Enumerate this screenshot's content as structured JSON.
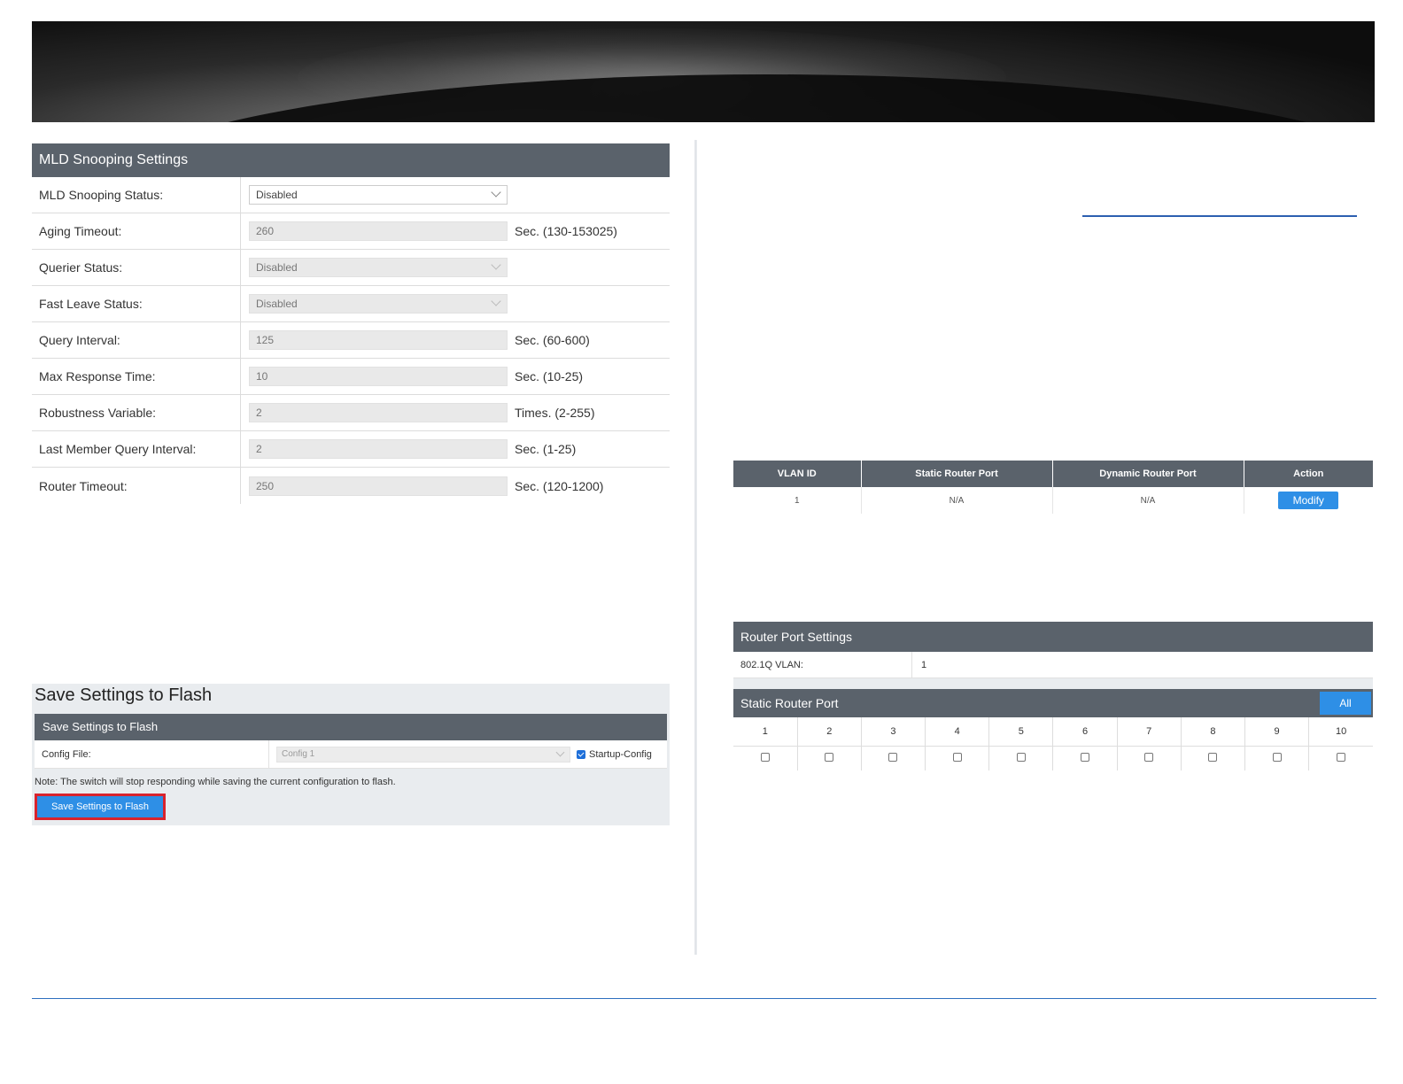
{
  "mld": {
    "title": "MLD Snooping Settings",
    "rows": [
      {
        "label": "MLD Snooping Status:",
        "value": "Disabled",
        "unit": ""
      },
      {
        "label": "Aging Timeout:",
        "value": "260",
        "unit": "Sec. (130-153025)"
      },
      {
        "label": "Querier Status:",
        "value": "Disabled",
        "unit": ""
      },
      {
        "label": "Fast Leave Status:",
        "value": "Disabled",
        "unit": ""
      },
      {
        "label": "Query Interval:",
        "value": "125",
        "unit": "Sec. (60-600)"
      },
      {
        "label": "Max Response Time:",
        "value": "10",
        "unit": "Sec. (10-25)"
      },
      {
        "label": "Robustness Variable:",
        "value": "2",
        "unit": "Times. (2-255)"
      },
      {
        "label": "Last Member Query Interval:",
        "value": "2",
        "unit": "Sec. (1-25)"
      },
      {
        "label": "Router Timeout:",
        "value": "250",
        "unit": "Sec. (120-1200)"
      }
    ]
  },
  "save": {
    "title": "Save Settings to Flash",
    "panel_title": "Save Settings to Flash",
    "config_label": "Config File:",
    "config_value": "Config 1",
    "startup_label": "Startup-Config",
    "note": "Note: The switch will stop responding while saving the current configuration to flash.",
    "button": "Save Settings to Flash"
  },
  "router_table": {
    "headers": [
      "VLAN ID",
      "Static Router Port",
      "Dynamic Router Port",
      "Action"
    ],
    "row": {
      "vlan": "1",
      "static": "N/A",
      "dynamic": "N/A",
      "action": "Modify"
    }
  },
  "router_port_settings": {
    "title": "Router Port Settings",
    "vlan_label": "802.1Q VLAN:",
    "vlan_value": "1",
    "static_title": "Static Router Port",
    "all_button": "All",
    "ports": [
      "1",
      "2",
      "3",
      "4",
      "5",
      "6",
      "7",
      "8",
      "9",
      "10"
    ]
  },
  "colors": {
    "panel_header": "#5a626b",
    "button_blue": "#2e8fe6",
    "highlight_red": "#d9232d"
  }
}
